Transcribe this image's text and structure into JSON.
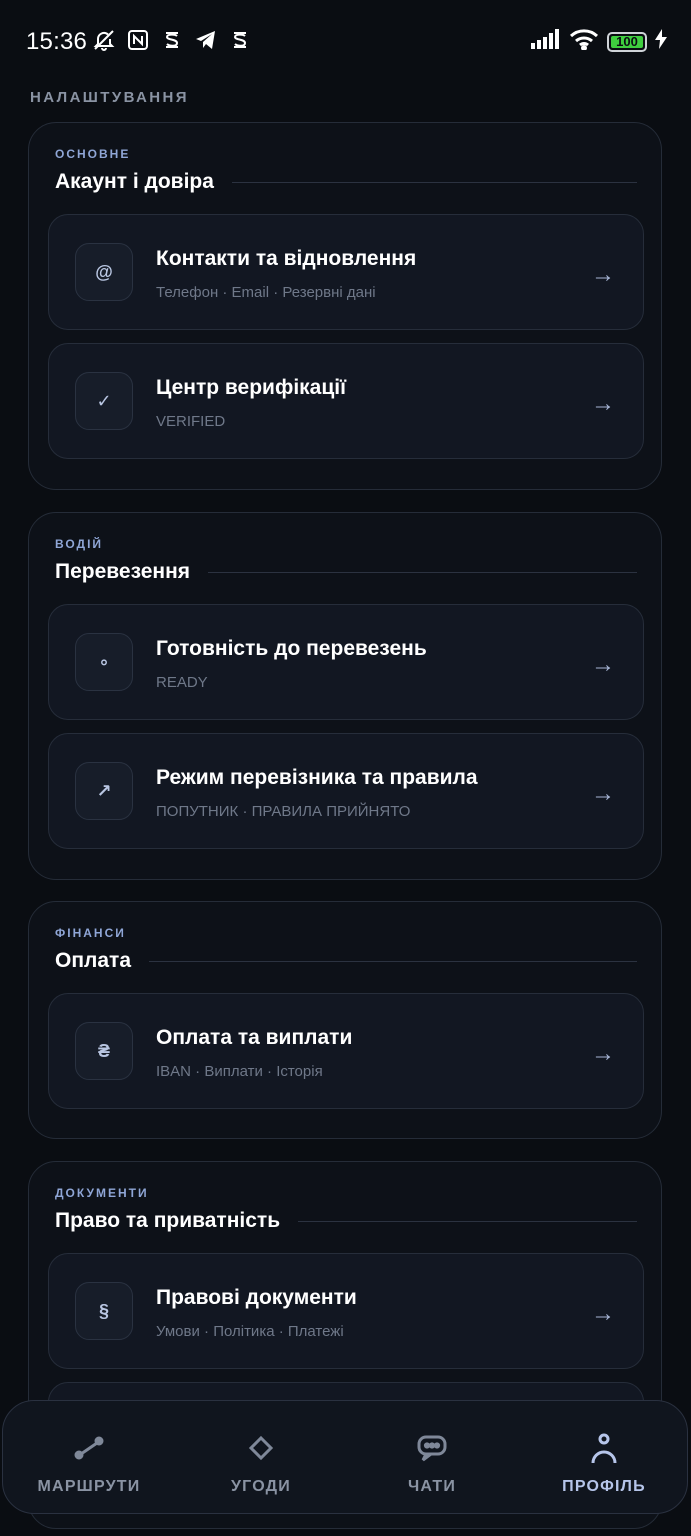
{
  "status_bar": {
    "time": "15:36",
    "battery": "100",
    "icons_left": [
      "bell-muted-icon",
      "nfc-icon",
      "s-app-icon",
      "telegram-icon",
      "s-app-icon"
    ],
    "icons_right": [
      "signal-icon",
      "wifi-icon",
      "battery-icon",
      "charging-icon"
    ]
  },
  "page": {
    "title": "НАЛАШТУВАННЯ"
  },
  "sections": [
    {
      "kicker": "ОСНОВНЕ",
      "title": "Акаунт і довіра",
      "items": [
        {
          "icon": "@",
          "icon_name": "at-icon",
          "title": "Контакти та відновлення",
          "subtitle": "Телефон · Email · Резервні дані"
        },
        {
          "icon": "✓",
          "icon_name": "check-icon",
          "title": "Центр верифікації",
          "subtitle": "VERIFIED"
        }
      ]
    },
    {
      "kicker": "ВОДІЙ",
      "title": "Перевезення",
      "items": [
        {
          "icon": "∘",
          "icon_name": "circle-icon",
          "title": "Готовність до перевезень",
          "subtitle": "READY"
        },
        {
          "icon": "↗",
          "icon_name": "arrow-up-right-icon",
          "title": "Режим перевізника та правила",
          "subtitle": "ПОПУТНИК · ПРАВИЛА ПРИЙНЯТО"
        }
      ]
    },
    {
      "kicker": "ФІНАНСИ",
      "title": "Оплата",
      "items": [
        {
          "icon": "₴",
          "icon_name": "hryvnia-icon",
          "title": "Оплата та виплати",
          "subtitle": "IBAN · Виплати · Історія"
        }
      ]
    },
    {
      "kicker": "ДОКУМЕНТИ",
      "title": "Право та приватність",
      "items": [
        {
          "icon": "§",
          "icon_name": "section-sign-icon",
          "title": "Правові документи",
          "subtitle": "Умови · Політика · Платежі"
        }
      ]
    }
  ],
  "row_arrow": "→",
  "bottom_nav": {
    "items": [
      {
        "label": "МАРШРУТИ",
        "icon_name": "route-icon",
        "active": false
      },
      {
        "label": "УГОДИ",
        "icon_name": "diamond-icon",
        "active": false
      },
      {
        "label": "ЧАТИ",
        "icon_name": "chat-icon",
        "active": false
      },
      {
        "label": "ПРОФІЛЬ",
        "icon_name": "profile-icon",
        "active": true
      }
    ]
  },
  "colors": {
    "background": "#0a0d12",
    "card": "#0d1118",
    "row": "#121722",
    "accent": "#8fa6d6",
    "muted": "#6f7889"
  }
}
